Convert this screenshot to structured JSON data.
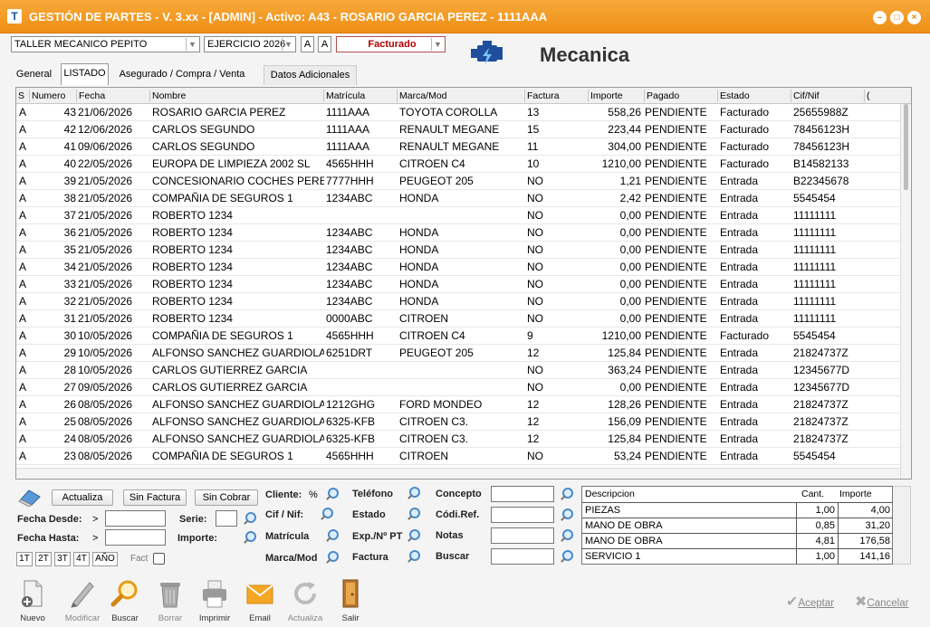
{
  "window": {
    "title": "GESTIÓN DE PARTES - V. 3.xx - [ADMIN] - Activo: A43 - ROSARIO GARCIA PEREZ - 1111AAA",
    "icon": "T"
  },
  "filters": {
    "taller": "TALLER MECANICO PEPITO",
    "ejercicio": "EJERCICIO 2026",
    "btn_a1": "A",
    "btn_a2": "A",
    "estado": "Facturado"
  },
  "module": {
    "title": "Mecanica",
    "icon": "engine-icon"
  },
  "tabs": [
    {
      "label": "General"
    },
    {
      "label": "LISTADO"
    },
    {
      "label": "Asegurado / Compra / Venta"
    },
    {
      "label": "Datos Adicionales"
    }
  ],
  "columns": [
    "S",
    "Numero",
    "Fecha",
    "Nombre",
    "Matrícula",
    "Marca/Mod",
    "Factura",
    "Importe",
    "Pagado",
    "Estado",
    "Cif/Nif",
    "("
  ],
  "rows": [
    [
      "A",
      "43",
      "21/06/2026",
      "ROSARIO GARCIA PEREZ",
      "1111AAA",
      "TOYOTA COROLLA",
      "13",
      "558,26",
      "PENDIENTE",
      "Facturado",
      "25655988Z"
    ],
    [
      "A",
      "42",
      "12/06/2026",
      "CARLOS SEGUNDO",
      "1111AAA",
      "RENAULT MEGANE",
      "15",
      "223,44",
      "PENDIENTE",
      "Facturado",
      "78456123H"
    ],
    [
      "A",
      "41",
      "09/06/2026",
      "CARLOS SEGUNDO",
      "1111AAA",
      "RENAULT MEGANE",
      "11",
      "304,00",
      "PENDIENTE",
      "Facturado",
      "78456123H"
    ],
    [
      "A",
      "40",
      "22/05/2026",
      "EUROPA DE LIMPIEZA 2002 SL",
      "4565HHH",
      "CITROEN C4",
      "10",
      "1210,00",
      "PENDIENTE",
      "Facturado",
      "B14582133"
    ],
    [
      "A",
      "39",
      "21/05/2026",
      "CONCESIONARIO COCHES PERE",
      "7777HHH",
      "PEUGEOT 205",
      "NO",
      "1,21",
      "PENDIENTE",
      "Entrada",
      "B22345678"
    ],
    [
      "A",
      "38",
      "21/05/2026",
      "COMPAÑIA DE SEGUROS 1",
      "1234ABC",
      "HONDA",
      "NO",
      "2,42",
      "PENDIENTE",
      "Entrada",
      "5545454"
    ],
    [
      "A",
      "37",
      "21/05/2026",
      "ROBERTO 1234",
      "",
      "",
      "NO",
      "0,00",
      "PENDIENTE",
      "Entrada",
      "11111111"
    ],
    [
      "A",
      "36",
      "21/05/2026",
      "ROBERTO 1234",
      "1234ABC",
      "HONDA",
      "NO",
      "0,00",
      "PENDIENTE",
      "Entrada",
      "11111111"
    ],
    [
      "A",
      "35",
      "21/05/2026",
      "ROBERTO 1234",
      "1234ABC",
      "HONDA",
      "NO",
      "0,00",
      "PENDIENTE",
      "Entrada",
      "11111111"
    ],
    [
      "A",
      "34",
      "21/05/2026",
      "ROBERTO 1234",
      "1234ABC",
      "HONDA",
      "NO",
      "0,00",
      "PENDIENTE",
      "Entrada",
      "11111111"
    ],
    [
      "A",
      "33",
      "21/05/2026",
      "ROBERTO 1234",
      "1234ABC",
      "HONDA",
      "NO",
      "0,00",
      "PENDIENTE",
      "Entrada",
      "11111111"
    ],
    [
      "A",
      "32",
      "21/05/2026",
      "ROBERTO 1234",
      "1234ABC",
      "HONDA",
      "NO",
      "0,00",
      "PENDIENTE",
      "Entrada",
      "11111111"
    ],
    [
      "A",
      "31",
      "21/05/2026",
      "ROBERTO 1234",
      "0000ABC",
      "CITROEN",
      "NO",
      "0,00",
      "PENDIENTE",
      "Entrada",
      "11111111"
    ],
    [
      "A",
      "30",
      "10/05/2026",
      "COMPAÑIA DE SEGUROS 1",
      "4565HHH",
      "CITROEN C4",
      "9",
      "1210,00",
      "PENDIENTE",
      "Facturado",
      "5545454"
    ],
    [
      "A",
      "29",
      "10/05/2026",
      "ALFONSO SANCHEZ GUARDIOLA",
      "6251DRT",
      "PEUGEOT 205",
      "12",
      "125,84",
      "PENDIENTE",
      "Entrada",
      "21824737Z"
    ],
    [
      "A",
      "28",
      "10/05/2026",
      "CARLOS GUTIERREZ GARCIA",
      "",
      "",
      "NO",
      "363,24",
      "PENDIENTE",
      "Entrada",
      "12345677D"
    ],
    [
      "A",
      "27",
      "09/05/2026",
      "CARLOS GUTIERREZ GARCIA",
      "",
      "",
      "NO",
      "0,00",
      "PENDIENTE",
      "Entrada",
      "12345677D"
    ],
    [
      "A",
      "26",
      "08/05/2026",
      "ALFONSO SANCHEZ GUARDIOLA",
      "1212GHG",
      "FORD MONDEO",
      "12",
      "128,26",
      "PENDIENTE",
      "Entrada",
      "21824737Z"
    ],
    [
      "A",
      "25",
      "08/05/2026",
      "ALFONSO SANCHEZ GUARDIOLA",
      "6325-KFB",
      "CITROEN C3.",
      "12",
      "156,09",
      "PENDIENTE",
      "Entrada",
      "21824737Z"
    ],
    [
      "A",
      "24",
      "08/05/2026",
      "ALFONSO SANCHEZ GUARDIOLA",
      "6325-KFB",
      "CITROEN C3.",
      "12",
      "125,84",
      "PENDIENTE",
      "Entrada",
      "21824737Z"
    ],
    [
      "A",
      "23",
      "08/05/2026",
      "COMPAÑIA DE SEGUROS 1",
      "4565HHH",
      "CITROEN",
      "NO",
      "53,24",
      "PENDIENTE",
      "Entrada",
      "5545454"
    ]
  ],
  "search": {
    "actualiza": "Actualiza",
    "sin_factura": "Sin Factura",
    "sin_cobrar": "Sin Cobrar",
    "fecha_desde": "Fecha Desde:",
    "fecha_hasta": "Fecha Hasta:",
    "gt": ">",
    "serie": "Serie:",
    "importe": "Importe:",
    "cliente": "Cliente:",
    "pct": "%",
    "cif": "Cif / Nif:",
    "matricula": "Matrícula",
    "marca": "Marca/Mod",
    "telefono": "Teléfono",
    "estado": "Estado",
    "exp": "Exp./Nº PT",
    "factura": "Factura",
    "concepto": "Concepto",
    "codi_ref": "Códi.Ref.",
    "notas": "Notas",
    "buscar": "Buscar",
    "quick": [
      "1T",
      "2T",
      "3T",
      "4T",
      "AÑO"
    ],
    "fact": "Fact"
  },
  "detail": {
    "headers": [
      "Descripcion",
      "Cant.",
      "Importe"
    ],
    "rows": [
      [
        "PIEZAS",
        "1,00",
        "4,00"
      ],
      [
        "MANO DE OBRA",
        "0,85",
        "31,20"
      ],
      [
        "MANO DE OBRA",
        "4,81",
        "176,58"
      ],
      [
        "SERVICIO 1",
        "1,00",
        "141,16"
      ]
    ]
  },
  "toolbar": [
    {
      "label": "Nuevo"
    },
    {
      "label": "Modificar"
    },
    {
      "label": "Buscar"
    },
    {
      "label": "Borrar"
    },
    {
      "label": "Imprimir"
    },
    {
      "label": "Email"
    },
    {
      "label": "Actualiza"
    },
    {
      "label": "Salir"
    }
  ],
  "actions": {
    "aceptar": "Aceptar",
    "cancelar": "Cancelar"
  }
}
